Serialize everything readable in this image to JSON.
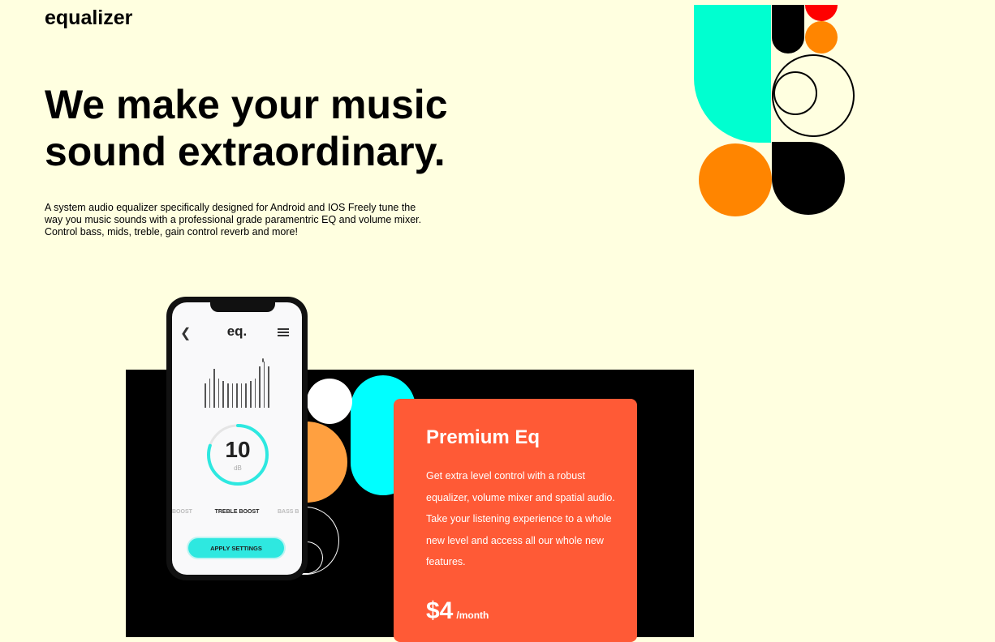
{
  "brand": {
    "logo": "equalizer"
  },
  "hero": {
    "headline_line1": "We make your music",
    "headline_line2": "sound extraordinary.",
    "description_line1": "A system audio equalizer specifically designed for Android and IOS Freely tune the",
    "description_line2": "way you music sounds with a professional grade paramentric EQ and volume mixer.",
    "description_line3": "Control bass, mids, treble, gain control reverb and more!"
  },
  "phone": {
    "app_title": "eq.",
    "back_icon": "chevron-left-icon",
    "menu_icon": "hamburger-menu-icon",
    "eq_band_levels": [
      0.5,
      0.6,
      0.8,
      0.6,
      0.55,
      0.5,
      0.5,
      0.5,
      0.5,
      0.5,
      0.55,
      0.6,
      0.85,
      0.95,
      0.85
    ],
    "dial_value": "10",
    "dial_unit": "dB",
    "dial_fraction": 0.8,
    "mode_left": "BOOST",
    "mode_center": "TREBLE BOOST",
    "mode_right": "BASS B",
    "apply_button": "APPLY SETTINGS"
  },
  "pricing": {
    "title": "Premium Eq",
    "text_line1": "Get extra level control with a robust",
    "text_line2": "equalizer, volume mixer and spatial audio.",
    "text_line3": "Take your listening experience to a whole",
    "text_line4": "new level and access all our whole new",
    "text_line5": "features.",
    "price": "$4",
    "period": "/month"
  },
  "colors": {
    "background": "#ffffe0",
    "teal": "#00ffd0",
    "orange": "#ff8500",
    "red": "#ff0000",
    "cyan": "#00ffff",
    "card": "#ff5a36",
    "accent": "#2ee8e0"
  }
}
